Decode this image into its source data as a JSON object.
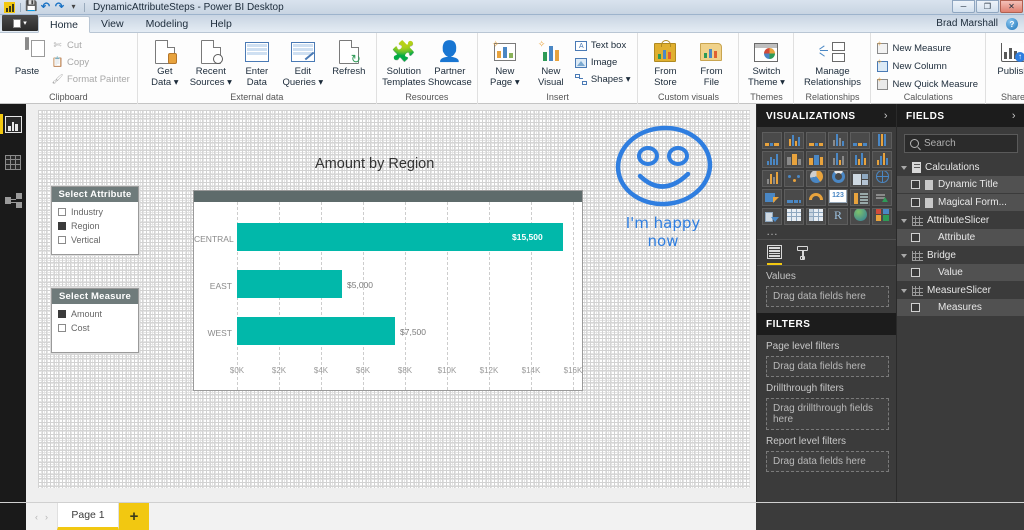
{
  "window": {
    "title": "DynamicAttributeSteps - Power BI Desktop",
    "user": "Brad Marshall",
    "quick_access": [
      {
        "name": "app-icon",
        "glyph": "power-bi-logo"
      },
      {
        "name": "save-icon",
        "glyph": "💾"
      },
      {
        "name": "undo-icon",
        "glyph": "↶"
      },
      {
        "name": "redo-icon",
        "glyph": "↷"
      },
      {
        "name": "customize-qat-icon",
        "glyph": "▾"
      }
    ],
    "buttons": {
      "minimize": "─",
      "maximize": "❐",
      "close": "✕"
    },
    "help_icon": "?"
  },
  "ribbon": {
    "file_label": "",
    "tabs": [
      {
        "label": "Home",
        "active": true
      },
      {
        "label": "View",
        "active": false
      },
      {
        "label": "Modeling",
        "active": false
      },
      {
        "label": "Help",
        "active": false
      }
    ],
    "groups": [
      {
        "name": "clipboard",
        "label": "Clipboard",
        "big": [
          {
            "label": "Paste",
            "icon": "paste-icon"
          }
        ],
        "small": [
          {
            "label": "Cut",
            "icon": "cut-icon",
            "dim": true
          },
          {
            "label": "Copy",
            "icon": "copy-icon",
            "dim": true
          },
          {
            "label": "Format Painter",
            "icon": "format-painter-icon",
            "dim": true
          }
        ]
      },
      {
        "name": "external-data",
        "label": "External data",
        "big": [
          {
            "label": "Get\nData ▾",
            "icon": "get-data-icon"
          },
          {
            "label": "Recent\nSources ▾",
            "icon": "recent-sources-icon"
          },
          {
            "label": "Enter\nData",
            "icon": "enter-data-icon"
          },
          {
            "label": "Edit\nQueries ▾",
            "icon": "edit-queries-icon"
          },
          {
            "label": "Refresh",
            "icon": "refresh-icon"
          }
        ]
      },
      {
        "name": "resources",
        "label": "Resources",
        "big": [
          {
            "label": "Solution\nTemplates",
            "icon": "solution-templates-icon"
          },
          {
            "label": "Partner\nShowcase",
            "icon": "partner-showcase-icon"
          }
        ]
      },
      {
        "name": "insert",
        "label": "Insert",
        "big": [
          {
            "label": "New\nPage ▾",
            "icon": "new-page-icon"
          },
          {
            "label": "New\nVisual",
            "icon": "new-visual-icon"
          }
        ],
        "small": [
          {
            "label": "Text box",
            "icon": "text-box-icon"
          },
          {
            "label": "Image",
            "icon": "image-icon"
          },
          {
            "label": "Shapes ▾",
            "icon": "shapes-icon"
          }
        ]
      },
      {
        "name": "custom-visuals",
        "label": "Custom visuals",
        "big": [
          {
            "label": "From\nStore",
            "icon": "from-store-icon"
          },
          {
            "label": "From\nFile",
            "icon": "from-file-icon"
          }
        ]
      },
      {
        "name": "themes",
        "label": "Themes",
        "big": [
          {
            "label": "Switch\nTheme ▾",
            "icon": "switch-theme-icon"
          }
        ]
      },
      {
        "name": "relationships",
        "label": "Relationships",
        "big": [
          {
            "label": "Manage\nRelationships",
            "icon": "manage-relationships-icon"
          }
        ]
      },
      {
        "name": "calculations",
        "label": "Calculations",
        "small": [
          {
            "label": "New Measure",
            "icon": "new-measure-icon"
          },
          {
            "label": "New Column",
            "icon": "new-column-icon"
          },
          {
            "label": "New Quick Measure",
            "icon": "new-quick-measure-icon"
          }
        ]
      },
      {
        "name": "share",
        "label": "Share",
        "big": [
          {
            "label": "Publish",
            "icon": "publish-icon"
          }
        ]
      }
    ]
  },
  "left_nav": [
    {
      "name": "report-view",
      "icon": "report-icon",
      "active": true
    },
    {
      "name": "data-view",
      "icon": "data-grid-icon",
      "active": false
    },
    {
      "name": "relationships-view",
      "icon": "model-icon",
      "active": false
    }
  ],
  "canvas": {
    "slicers": [
      {
        "title": "Select Attribute",
        "items": [
          {
            "label": "Industry",
            "checked": false
          },
          {
            "label": "Region",
            "checked": true
          },
          {
            "label": "Vertical",
            "checked": false
          }
        ]
      },
      {
        "title": "Select Measure",
        "items": [
          {
            "label": "Amount",
            "checked": true
          },
          {
            "label": "Cost",
            "checked": false
          }
        ]
      }
    ],
    "annotation": {
      "shape": "hand-drawn-smiley-face",
      "text_line1": "I'm happy",
      "text_line2": "now",
      "ink_color": "#2f7ee0"
    }
  },
  "chart_data": {
    "type": "bar",
    "orientation": "horizontal",
    "title": "Amount by Region",
    "categories": [
      "CENTRAL",
      "EAST",
      "WEST"
    ],
    "values": [
      15500,
      5000,
      7500
    ],
    "value_labels": [
      "$15,500",
      "$5,000",
      "$7,500"
    ],
    "xlabel": "",
    "ylabel": "",
    "xlim": [
      0,
      16000
    ],
    "xticks": [
      0,
      2000,
      4000,
      6000,
      8000,
      10000,
      12000,
      14000,
      16000
    ],
    "xtick_labels": [
      "$0K",
      "$2K",
      "$4K",
      "$6K",
      "$8K",
      "$10K",
      "$12K",
      "$14K",
      "$16K"
    ],
    "series_color": "#01b8aa",
    "grid": true,
    "legend": "none"
  },
  "visualizations_pane": {
    "title": "VISUALIZATIONS",
    "collapse_icon": "›",
    "icons": [
      "stacked-bar-chart-icon",
      "stacked-column-chart-icon",
      "clustered-bar-chart-icon",
      "clustered-column-chart-icon",
      "100-stacked-bar-chart-icon",
      "100-stacked-column-chart-icon",
      "line-chart-icon",
      "area-chart-icon",
      "stacked-area-chart-icon",
      "line-stacked-column-chart-icon",
      "line-clustered-column-chart-icon",
      "ribbon-chart-icon",
      "waterfall-chart-icon",
      "scatter-chart-icon",
      "pie-chart-icon",
      "donut-chart-icon",
      "treemap-icon",
      "map-icon",
      "filled-map-icon",
      "funnel-icon",
      "gauge-icon",
      "card-icon",
      "multi-row-card-icon",
      "kpi-icon",
      "slicer-icon",
      "table-icon",
      "matrix-icon",
      "r-script-visual-icon",
      "arcgis-map-icon",
      "get-more-visuals-icon"
    ],
    "more_icon": "…",
    "tabs": [
      {
        "name": "fields-tab",
        "icon": "fields-grid-icon",
        "active": true
      },
      {
        "name": "format-tab",
        "icon": "paint-roller-icon",
        "active": false
      }
    ],
    "values_label": "Values",
    "values_dropzone": "Drag data fields here"
  },
  "filters_pane": {
    "title": "FILTERS",
    "sections": [
      {
        "label": "Page level filters",
        "dropzone": "Drag data fields here"
      },
      {
        "label": "Drillthrough filters",
        "dropzone": "Drag drillthrough fields here"
      },
      {
        "label": "Report level filters",
        "dropzone": "Drag data fields here"
      }
    ]
  },
  "fields_pane": {
    "title": "FIELDS",
    "collapse_icon": "›",
    "search_placeholder": "Search",
    "search_value": "",
    "tables": [
      {
        "name": "Calculations",
        "icon": "calculations-table-icon",
        "expanded": true,
        "fields": [
          {
            "label": "Dynamic Title",
            "checked": false,
            "icon": "measure-icon"
          },
          {
            "label": "Magical Form...",
            "checked": false,
            "icon": "measure-icon"
          }
        ]
      },
      {
        "name": "AttributeSlicer",
        "icon": "table-icon",
        "expanded": true,
        "fields": [
          {
            "label": "Attribute",
            "checked": false,
            "icon": "column-icon"
          }
        ]
      },
      {
        "name": "Bridge",
        "icon": "table-icon",
        "expanded": true,
        "fields": [
          {
            "label": "Value",
            "checked": false,
            "icon": "column-icon"
          }
        ]
      },
      {
        "name": "MeasureSlicer",
        "icon": "table-icon",
        "expanded": true,
        "fields": [
          {
            "label": "Measures",
            "checked": false,
            "icon": "column-icon"
          }
        ]
      }
    ]
  },
  "page_bar": {
    "prev_icon": "‹",
    "next_icon": "›",
    "pages": [
      {
        "label": "Page 1",
        "active": true
      }
    ],
    "add_page_icon": "+"
  },
  "colors": {
    "accent_yellow": "#f2c811",
    "series_teal": "#01b8aa",
    "pane_dark": "#3b3b3b",
    "ink_blue": "#2f7ee0"
  }
}
